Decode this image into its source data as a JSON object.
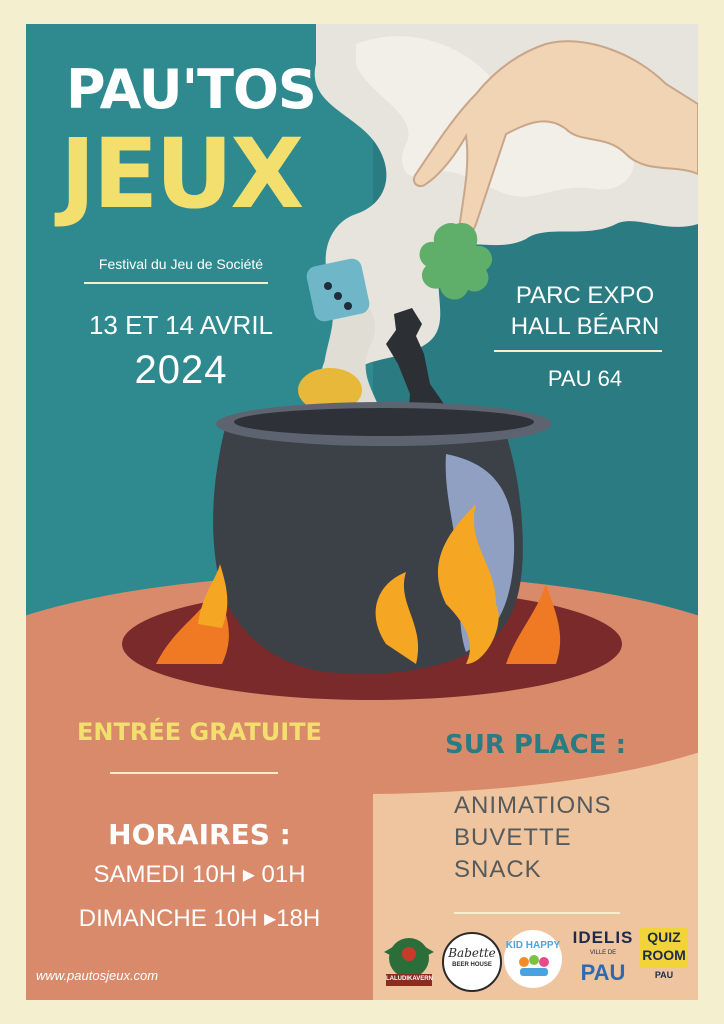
{
  "festival": {
    "title_line1": "PAU'TOS",
    "title_line2": "JEUX",
    "subtitle": "Festival du Jeu de Société"
  },
  "dates": {
    "line1": "13 ET 14 AVRIL",
    "year": "2024"
  },
  "venue": {
    "line1": "PARC EXPO",
    "line2": "HALL BÉARN",
    "city": "PAU 64"
  },
  "info": {
    "entry": "ENTRÉE GRATUITE",
    "hours_heading": "HORAIRES :",
    "saturday": "SAMEDI 10H ▸ 01H",
    "sunday": "DIMANCHE 10H ▸18H"
  },
  "on_site": {
    "heading": "SUR PLACE :",
    "items": [
      "ANIMATIONS",
      "BUVETTE",
      "SNACK"
    ]
  },
  "footer": {
    "website": "www.pautosjeux.com"
  },
  "sponsors": {
    "laludikavern": "LALUDIKAVERN",
    "babette_name": "Babette",
    "babette_sub": "BEER HOUSE",
    "kidhappy": "KID HAPPY",
    "idelis": "IDELIS",
    "ville_label": "VILLE DE",
    "pau": "PAU",
    "quiz1": "QUIZ",
    "quiz2": "ROOM",
    "quiz3": "PAU"
  },
  "colors": {
    "teal": "#2f8a8f",
    "yellow": "#f2df6e",
    "terracotta": "#d98a6a",
    "peach": "#efc5a0",
    "cream": "#f4efcf"
  }
}
